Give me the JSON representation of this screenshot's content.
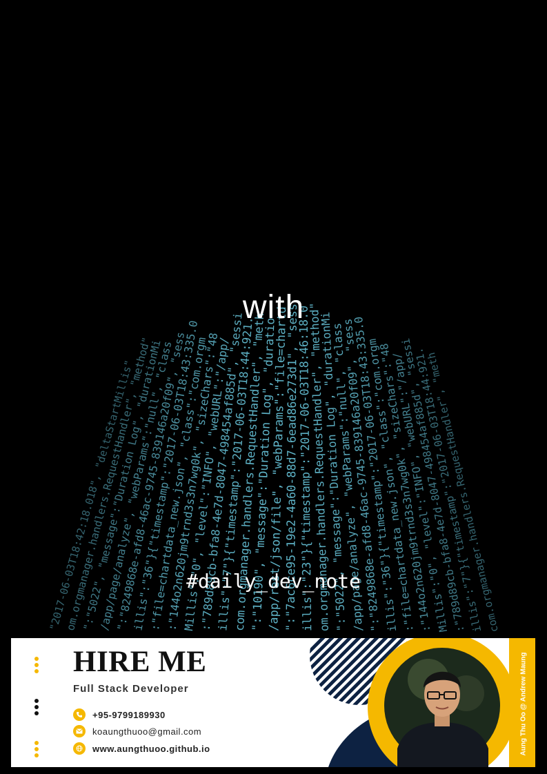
{
  "poster": {
    "headline": "with",
    "hashtag": "#daily_dev_note",
    "code_lines": [
      "\"2017-06-03T18:42:18.018\", \"deltaStartMillis\"",
      "om.orgmanager.handlers.RequestHandler\", \"method\"",
      "\":\"5022\", \"message\":\"Duration Log\", \"durationMi",
      "/app/page/analyze\", \"webParams\":\"null\", \"class",
      "\":\"8249868e-afd8-46ac-9745-839146a20f09\", \"sess",
      "illis\":\"36\"}{\"timestamp\":\"2017-06-03T18:43:335.0",
      ":\"file=chartdata_new.json\", \"class\":\"com.orgm",
      ":\"144o2n620jm9trnd3s3n7wg0k\", \"sizeChars\":\"48",
      "Millis\":\"0\", \"level\":\"INFO\", \"webURL\":\"/app/",
      ":\"789d89cb-bfa8-4e7d-8047-498454af885d\", \"sessi",
      "illis\":\"7\"}{\"timestamp\":\"2017-06-03T18:44:921.",
      "com.orgmanager.handlers.RequestHandler\", \"meth",
      "\":\"10190\", \"message\":\"Duration Log\", \"duratio",
      "/app/rest/json/file\", \"webParams\":\"file=chartd",
      "\":\"7ac6ce95-19e2-4a60-88d7-6ead86e273d1\", \"sess",
      "illis\":\"23\"}{\"timestamp\":\"2017-06-03T18:46:18.0",
      "om.orgmanager.handlers.RequestHandler\", \"method\"",
      "\":\"5022\", \"message\":\"Duration Log\", \"durationMi",
      "/app/page/analyze\", \"webParams\":\"null\", \"class",
      "\":\"8249868e-afd8-46ac-9745-839146a20f09\", \"sess",
      "illis\":\"36\"}{\"timestamp\":\"2017-06-03T18:43:335.0",
      ":\"file=chartdata_new.json\", \"class\":\"com.orgm",
      ":\"144o2n620jm9trnd3s3n7wg0k\", \"sizeChars\":\"48",
      "Millis\":\"0\", \"level\":\"INFO\", \"webURL\":\"/app/",
      ":\"789d89cb-bfa8-4e7d-8047-498454af885d\", \"sessi",
      "illis\":\"7\"}{\"timestamp\":\"2017-06-03T18:44:921.",
      "com.orgmanager.handlers.RequestHandler\", \"meth"
    ],
    "colors": {
      "background": "#000000",
      "code_text": "#5fb4c8",
      "accent_yellow": "#f5b800",
      "navy": "#0d2242"
    }
  },
  "card": {
    "title": "HIRE ME",
    "role": "Full Stack Developer",
    "phone": "+95-9799189930",
    "email": "koaungthuoo@gmail.com",
    "website": "www.aungthuoo.github.io",
    "credit": "Aung Thu Oo @ Andrew Maung",
    "icons": {
      "phone": "phone-icon",
      "email": "mail-icon",
      "website": "globe-icon"
    }
  }
}
